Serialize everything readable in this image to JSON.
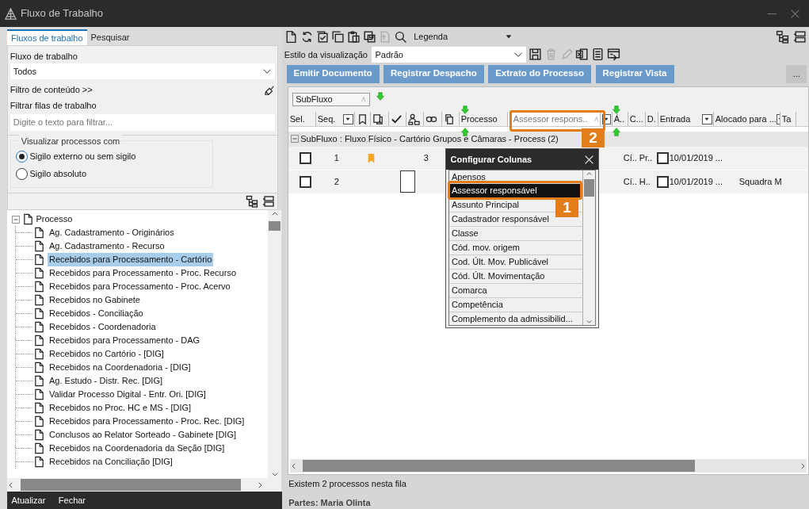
{
  "window": {
    "title": "Fluxo de Trabalho"
  },
  "left_panel": {
    "tabs": [
      {
        "label": "Fluxos de trabalho",
        "selected": true
      },
      {
        "label": "Pesquisar",
        "selected": false
      }
    ],
    "workflow": {
      "label": "Fluxo de trabalho",
      "value": "Todos"
    },
    "content_filter_link": "Filtro de conteúdo >>",
    "queue_filter": {
      "label": "Filtrar filas de trabalho",
      "placeholder": "Digite o texto para filtrar..."
    },
    "visibility": {
      "legend": "Visualizar processos com",
      "options": [
        {
          "label": "Sigilo externo ou sem sigilo",
          "selected": true
        },
        {
          "label": "Sigilo absoluto",
          "selected": false
        }
      ]
    },
    "tree": {
      "label": "Processo",
      "expanded": true,
      "children": [
        {
          "label": "Ag. Cadastramento - Originários",
          "selected": false
        },
        {
          "label": "Ag. Cadastramento - Recurso",
          "selected": false
        },
        {
          "label": "Recebidos para Processamento - Cartório",
          "selected": true
        },
        {
          "label": "Recebidos para Processamento - Proc. Recurso",
          "selected": false
        },
        {
          "label": "Recebidos para Processamento - Proc. Acervo",
          "selected": false
        },
        {
          "label": "Recebidos no Gabinete",
          "selected": false
        },
        {
          "label": "Recebidos - Conciliação",
          "selected": false
        },
        {
          "label": "Recebidos - Coordenadoria",
          "selected": false
        },
        {
          "label": "Recebidos para Processamento - DAG",
          "selected": false
        },
        {
          "label": "Recebidos no Cartório - [DIG]",
          "selected": false
        },
        {
          "label": "Recebidos na Coordenadoria - [DIG]",
          "selected": false
        },
        {
          "label": "Ag. Estudo - Distr. Rec. [DIG]",
          "selected": false
        },
        {
          "label": "Validar Processo Digital - Entr. Ori. [DIG]",
          "selected": false
        },
        {
          "label": "Recebidos no Proc. HC e MS - [DIG]",
          "selected": false
        },
        {
          "label": "Recebidos para Processamento - Proc. Rec. [DIG]",
          "selected": false
        },
        {
          "label": "Conclusos ao Relator Sorteado - Gabinete [DIG]",
          "selected": false
        },
        {
          "label": "Recebidos na Coordenadoria da Seção [DIG]",
          "selected": false
        },
        {
          "label": "Recebidos na Conciliação [DIG]",
          "selected": false
        }
      ]
    },
    "footer_buttons": [
      "Atualizar",
      "Fechar"
    ]
  },
  "right_panel": {
    "toolbar": {
      "legend_label": "Legenda"
    },
    "view_style": {
      "label": "Estilo da visualização",
      "value": "Padrão"
    },
    "actions": [
      "Emitir Documento",
      "Registrar Despacho",
      "Extrato do Processo",
      "Registrar Vista",
      "..."
    ],
    "group_by": "SubFluxo",
    "columns": [
      {
        "kind": "text",
        "label": "Sel.",
        "dropdown": false
      },
      {
        "kind": "text",
        "label": "Seq.",
        "dropdown": true
      },
      {
        "kind": "icon"
      },
      {
        "kind": "icon"
      },
      {
        "kind": "icon"
      },
      {
        "kind": "icon"
      },
      {
        "kind": "icon"
      },
      {
        "kind": "icon"
      },
      {
        "kind": "text",
        "label": "Processo",
        "dropdown": false
      },
      {
        "kind": "dragged",
        "label": "Assessor respons.."
      },
      {
        "kind": "text",
        "dropdown": true
      },
      {
        "kind": "text",
        "label": "Á..",
        "dropdown": false
      },
      {
        "kind": "text",
        "label": "C...",
        "dropdown": false
      },
      {
        "kind": "text",
        "label": "D.",
        "dropdown": false
      },
      {
        "kind": "text",
        "label": "Entrada",
        "dropdown": true
      },
      {
        "kind": "text",
        "label": "Alocado para ...",
        "dropdown": true
      },
      {
        "kind": "text",
        "label": "Ta",
        "dropdown": false
      }
    ],
    "group": {
      "label": "SubFluxo : Fluxo Físico - Cartório Grupos e Câmaras - Process",
      "count": "(2)",
      "expanded": true
    },
    "rows": [
      {
        "checked": false,
        "seq": "1",
        "bookmarked": true,
        "attachment": false,
        "link": "3",
        "area": "Cí..",
        "class": "Pr..",
        "flag": false,
        "entry": "10/01/2019 ...",
        "assigned": ""
      },
      {
        "checked": false,
        "seq": "2",
        "bookmarked": false,
        "attachment": true,
        "link": "",
        "area": "Cí..",
        "class": "H..",
        "flag": false,
        "entry": "10/01/2019 ...",
        "assigned": "Squadra M"
      }
    ],
    "status": "Existem 2 processos nesta fila",
    "parties": "Partes: Maria Olinta"
  },
  "column_dialog": {
    "title": "Configurar Colunas",
    "items": [
      {
        "label": "Apensos",
        "selected": false
      },
      {
        "label": "Assessor responsável",
        "selected": true
      },
      {
        "label": "Assunto Principal",
        "selected": false
      },
      {
        "label": "Cadastrador responsável",
        "selected": false
      },
      {
        "label": "Classe",
        "selected": false
      },
      {
        "label": "Cód. mov. origem",
        "selected": false
      },
      {
        "label": "Cod. Últ. Mov. Publicável",
        "selected": false
      },
      {
        "label": "Cód. Últ. Movimentação",
        "selected": false
      },
      {
        "label": "Comarca",
        "selected": false
      },
      {
        "label": "Competência",
        "selected": false
      },
      {
        "label": "Complemento da admissibilid...",
        "selected": false
      }
    ]
  },
  "callouts": [
    "1",
    "2"
  ]
}
